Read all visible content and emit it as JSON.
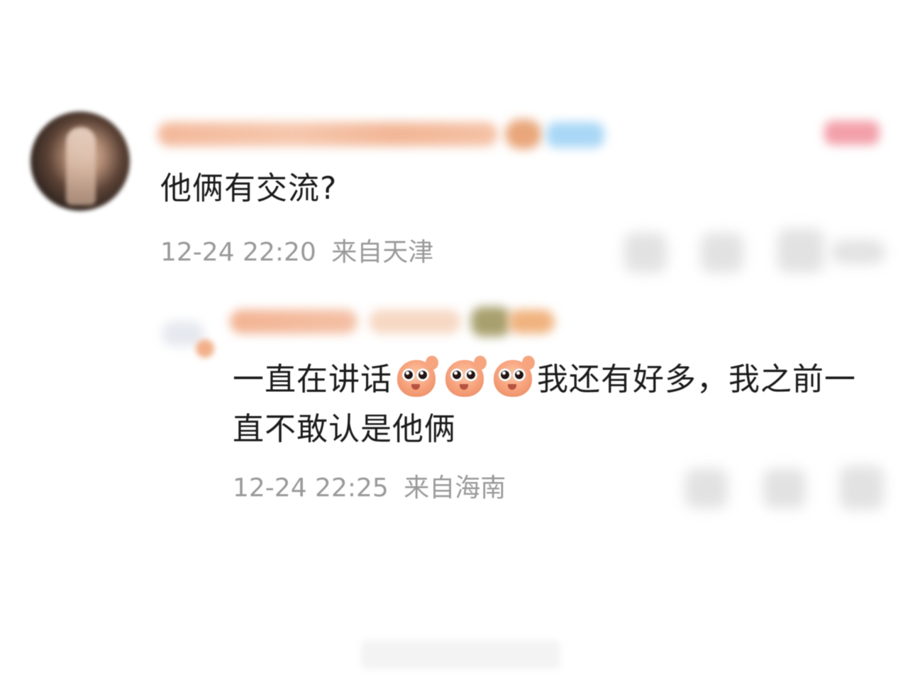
{
  "main_comment": {
    "text": "他俩有交流?",
    "timestamp": "12-24 22:20",
    "location": "来自天津"
  },
  "reply": {
    "text_part1": "一直在讲话",
    "text_part2": "我还有好多，我之前一直不敢认是他俩",
    "emojis": [
      "shining-eyes-emoji",
      "shining-eyes-emoji",
      "shining-eyes-emoji"
    ],
    "timestamp": "12-24 22:25",
    "location": "来自海南"
  },
  "colors": {
    "text_primary": "#1c1c1c",
    "text_meta": "#9a9a9a",
    "username_blur": "#f3b89a",
    "vip_badge": "#a9d7f6",
    "tag": "#f3a0aa"
  },
  "icons": {
    "actions": [
      "share-icon",
      "comment-icon",
      "like-icon"
    ]
  }
}
